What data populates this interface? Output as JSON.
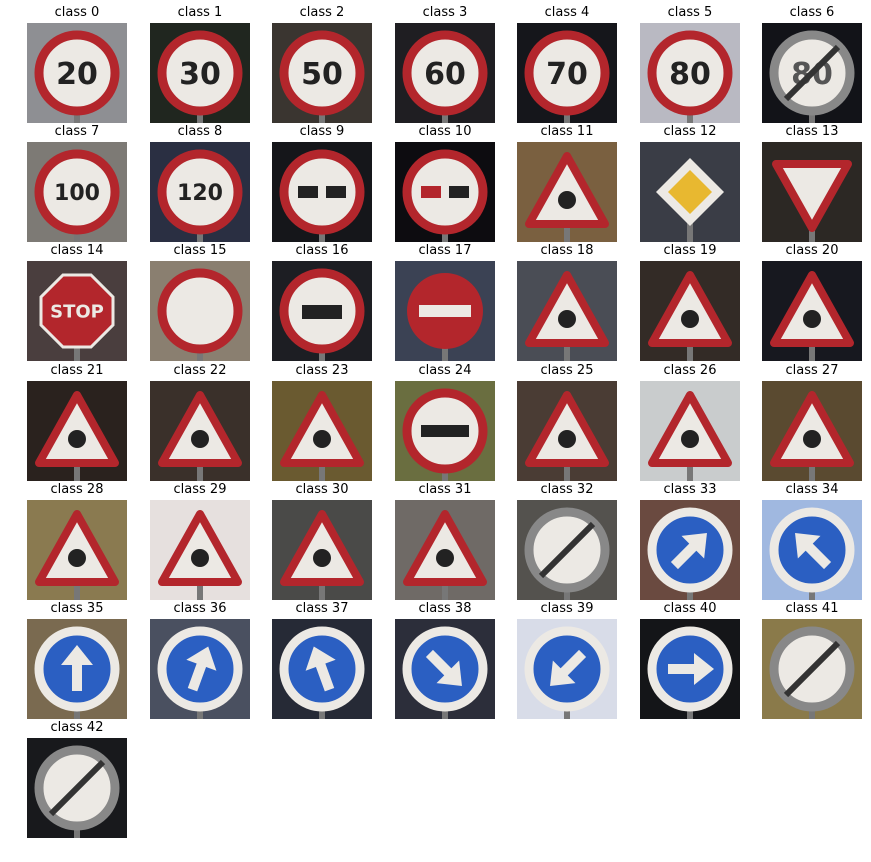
{
  "figure": {
    "cells": [
      {
        "label": "class 0",
        "sign": "speed-limit-20",
        "bg": "#8e8f93",
        "glyph": "20"
      },
      {
        "label": "class 1",
        "sign": "speed-limit-30",
        "bg": "#20261f",
        "glyph": "30"
      },
      {
        "label": "class 2",
        "sign": "speed-limit-50",
        "bg": "#3a3530",
        "glyph": "50"
      },
      {
        "label": "class 3",
        "sign": "speed-limit-60",
        "bg": "#1f1e22",
        "glyph": "60"
      },
      {
        "label": "class 4",
        "sign": "speed-limit-70",
        "bg": "#15161b",
        "glyph": "70"
      },
      {
        "label": "class 5",
        "sign": "speed-limit-80",
        "bg": "#b9b9c2",
        "glyph": "80"
      },
      {
        "label": "class 6",
        "sign": "end-speed-limit-80",
        "bg": "#121318",
        "glyph": "80"
      },
      {
        "label": "class 7",
        "sign": "speed-limit-100",
        "bg": "#7d7a75",
        "glyph": "100"
      },
      {
        "label": "class 8",
        "sign": "speed-limit-120",
        "bg": "#2a2f42",
        "glyph": "120"
      },
      {
        "label": "class 9",
        "sign": "no-passing",
        "bg": "#15161a",
        "glyph": ""
      },
      {
        "label": "class 10",
        "sign": "no-passing-trucks",
        "bg": "#0d0c10",
        "glyph": ""
      },
      {
        "label": "class 11",
        "sign": "right-of-way-intersection",
        "bg": "#7a6040",
        "glyph": ""
      },
      {
        "label": "class 12",
        "sign": "priority-road",
        "bg": "#3a3d46",
        "glyph": ""
      },
      {
        "label": "class 13",
        "sign": "yield",
        "bg": "#2c2824",
        "glyph": ""
      },
      {
        "label": "class 14",
        "sign": "stop",
        "bg": "#4a3e3e",
        "glyph": ""
      },
      {
        "label": "class 15",
        "sign": "no-vehicles",
        "bg": "#8a7f70",
        "glyph": ""
      },
      {
        "label": "class 16",
        "sign": "no-trucks",
        "bg": "#1d1e23",
        "glyph": ""
      },
      {
        "label": "class 17",
        "sign": "no-entry",
        "bg": "#3b4254",
        "glyph": ""
      },
      {
        "label": "class 18",
        "sign": "general-caution",
        "bg": "#4a4d55",
        "glyph": ""
      },
      {
        "label": "class 19",
        "sign": "dangerous-curve-left",
        "bg": "#332b26",
        "glyph": ""
      },
      {
        "label": "class 20",
        "sign": "dangerous-curve-right",
        "bg": "#17181f",
        "glyph": ""
      },
      {
        "label": "class 21",
        "sign": "double-curve",
        "bg": "#2a221e",
        "glyph": ""
      },
      {
        "label": "class 22",
        "sign": "bumpy-road",
        "bg": "#3a302a",
        "glyph": ""
      },
      {
        "label": "class 23",
        "sign": "slippery-road",
        "bg": "#6a5a30",
        "glyph": ""
      },
      {
        "label": "class 24",
        "sign": "road-narrows-right",
        "bg": "#6a6e40",
        "glyph": ""
      },
      {
        "label": "class 25",
        "sign": "road-work",
        "bg": "#4a3c34",
        "glyph": ""
      },
      {
        "label": "class 26",
        "sign": "traffic-signals",
        "bg": "#c9cccd",
        "glyph": ""
      },
      {
        "label": "class 27",
        "sign": "pedestrians",
        "bg": "#5a4a30",
        "glyph": ""
      },
      {
        "label": "class 28",
        "sign": "children-crossing",
        "bg": "#8a7a50",
        "glyph": ""
      },
      {
        "label": "class 29",
        "sign": "bicycles-crossing",
        "bg": "#e6e0de",
        "glyph": ""
      },
      {
        "label": "class 30",
        "sign": "beware-ice-snow",
        "bg": "#4a4a48",
        "glyph": ""
      },
      {
        "label": "class 31",
        "sign": "wild-animals-crossing",
        "bg": "#6f6a66",
        "glyph": ""
      },
      {
        "label": "class 32",
        "sign": "end-all-limits",
        "bg": "#54524e",
        "glyph": ""
      },
      {
        "label": "class 33",
        "sign": "turn-right-ahead",
        "bg": "#6a4a40",
        "glyph": ""
      },
      {
        "label": "class 34",
        "sign": "turn-left-ahead",
        "bg": "#a0b8e0",
        "glyph": ""
      },
      {
        "label": "class 35",
        "sign": "ahead-only",
        "bg": "#7a6a50",
        "glyph": ""
      },
      {
        "label": "class 36",
        "sign": "go-straight-or-right",
        "bg": "#4a5060",
        "glyph": ""
      },
      {
        "label": "class 37",
        "sign": "go-straight-or-left",
        "bg": "#262a36",
        "glyph": ""
      },
      {
        "label": "class 38",
        "sign": "keep-right",
        "bg": "#2c2e3a",
        "glyph": ""
      },
      {
        "label": "class 39",
        "sign": "keep-left",
        "bg": "#d8dce8",
        "glyph": ""
      },
      {
        "label": "class 40",
        "sign": "roundabout-mandatory",
        "bg": "#141518",
        "glyph": ""
      },
      {
        "label": "class 41",
        "sign": "end-no-passing",
        "bg": "#8a7a4a",
        "glyph": ""
      },
      {
        "label": "class 42",
        "sign": "end-no-passing-trucks",
        "bg": "#18191c",
        "glyph": ""
      }
    ]
  }
}
